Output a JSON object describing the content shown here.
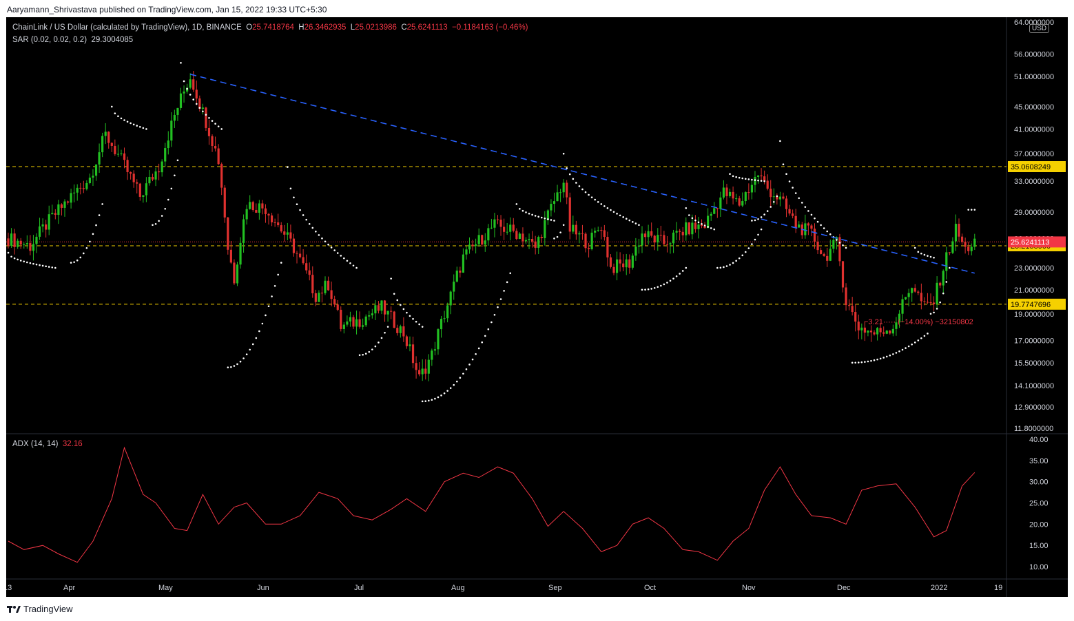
{
  "publisher": "Aaryamann_Shrivastava published on TradingView.com, Jan 15, 2022 19:33 UTC+5:30",
  "legend": {
    "symbol": "ChainLink / US Dollar (calculated by TradingView), 1D, BINANCE",
    "o_label": "O",
    "o": "25.7418764",
    "h_label": "H",
    "h": "26.3462935",
    "l_label": "L",
    "l": "25.0213986",
    "c_label": "C",
    "c": "25.6241113",
    "chg": "−0.1184163 (−0.46%)",
    "sar_label": "SAR (0.02, 0.02, 0.2)",
    "sar_value": "29.3004085",
    "adx_label": "ADX (14, 14)",
    "adx_value": "32.16"
  },
  "currency": "USD",
  "footer": {
    "brand": "TradingView"
  },
  "colors": {
    "background": "#000000",
    "up": "#22c022",
    "down": "#e0312f",
    "sar": "#ffffff",
    "adx": "#f23645",
    "trendline": "#2962ff",
    "hline": "#f5d000",
    "price_line": "#f23645"
  },
  "chart_data": {
    "type": "candlestick",
    "price_axis": {
      "scale": "log",
      "labels": [
        "64.0000000",
        "56.0000000",
        "51.0000000",
        "45.0000000",
        "41.0000000",
        "37.0000000",
        "33.0000000",
        "29.0000000",
        "26.0000000",
        "23.0000000",
        "21.0000000",
        "19.0000000",
        "17.0000000",
        "15.5000000",
        "14.1000000",
        "12.9000000",
        "11.8000000"
      ]
    },
    "time_axis": {
      "labels": [
        "13",
        "Apr",
        "May",
        "Jun",
        "Jul",
        "Aug",
        "Sep",
        "Oct",
        "Nov",
        "Dec",
        "2022",
        "19"
      ]
    },
    "close_path": [
      [
        "Mar 13",
        26.0
      ],
      [
        "Mar 20",
        25.2
      ],
      [
        "Mar 25",
        27.5
      ],
      [
        "Apr 1",
        30.5
      ],
      [
        "Apr 8",
        33.5
      ],
      [
        "Apr 13",
        40.0
      ],
      [
        "Apr 18",
        36.0
      ],
      [
        "Apr 24",
        31.0
      ],
      [
        "Apr 30",
        35.0
      ],
      [
        "May 6",
        45.0
      ],
      [
        "May 10",
        51.0
      ],
      [
        "May 14",
        44.0
      ],
      [
        "May 19",
        36.0
      ],
      [
        "May 22",
        25.0
      ],
      [
        "May 24",
        22.0
      ],
      [
        "May 28",
        30.0
      ],
      [
        "Jun 3",
        29.5
      ],
      [
        "Jun 12",
        25.0
      ],
      [
        "Jun 19",
        20.5
      ],
      [
        "Jun 23",
        21.5
      ],
      [
        "Jun 27",
        18.0
      ],
      [
        "Jul 3",
        18.5
      ],
      [
        "Jul 10",
        19.5
      ],
      [
        "Jul 17",
        17.5
      ],
      [
        "Jul 22",
        14.5
      ],
      [
        "Jul 26",
        16.0
      ],
      [
        "Aug 1",
        20.5
      ],
      [
        "Aug 5",
        24.0
      ],
      [
        "Aug 15",
        27.5
      ],
      [
        "Aug 23",
        26.5
      ],
      [
        "Aug 28",
        25.0
      ],
      [
        "Sep 2",
        29.5
      ],
      [
        "Sep 6",
        33.0
      ],
      [
        "Sep 8",
        27.0
      ],
      [
        "Sep 14",
        25.5
      ],
      [
        "Sep 18",
        27.5
      ],
      [
        "Sep 21",
        23.0
      ],
      [
        "Sep 27",
        23.5
      ],
      [
        "Oct 1",
        26.5
      ],
      [
        "Oct 8",
        25.5
      ],
      [
        "Oct 15",
        27.0
      ],
      [
        "Oct 21",
        27.5
      ],
      [
        "Oct 27",
        31.5
      ],
      [
        "Nov 1",
        30.0
      ],
      [
        "Nov 7",
        34.0
      ],
      [
        "Nov 10",
        32.0
      ],
      [
        "Nov 14",
        30.5
      ],
      [
        "Nov 19",
        27.5
      ],
      [
        "Nov 24",
        26.5
      ],
      [
        "Nov 28",
        24.0
      ],
      [
        "Dec 2",
        25.5
      ],
      [
        "Dec 5",
        20.0
      ],
      [
        "Dec 9",
        18.0
      ],
      [
        "Dec 14",
        17.5
      ],
      [
        "Dec 20",
        18.0
      ],
      [
        "Dec 26",
        21.5
      ],
      [
        "Dec 30",
        19.5
      ],
      [
        "Jan 2",
        20.0
      ],
      [
        "Jan 6",
        24.0
      ],
      [
        "Jan 9",
        27.0
      ],
      [
        "Jan 12",
        24.8
      ],
      [
        "Jan 15",
        25.6241113
      ]
    ],
    "sar_segments": [
      {
        "from": "Mar 13",
        "to": "Mar 28",
        "start": 24.5,
        "end": 23.0,
        "side": "above"
      },
      {
        "from": "Apr 2",
        "to": "Apr 12",
        "start": 23.5,
        "end": 30.0,
        "side": "below"
      },
      {
        "from": "Apr 15",
        "to": "Apr 26",
        "start": 45.0,
        "end": 41.0,
        "side": "above"
      },
      {
        "from": "Apr 28",
        "to": "May 6",
        "start": 27.5,
        "end": 36.0,
        "side": "below"
      },
      {
        "from": "May 7",
        "to": "May 20",
        "start": 54.0,
        "end": 41.0,
        "side": "above"
      },
      {
        "from": "May 22",
        "to": "Jun 8",
        "start": 15.2,
        "end": 23.5,
        "side": "below"
      },
      {
        "from": "Jun 10",
        "to": "Jul 2",
        "start": 35.0,
        "end": 23.0,
        "side": "above"
      },
      {
        "from": "Jul 3",
        "to": "Jul 12",
        "start": 16.0,
        "end": 18.0,
        "side": "below"
      },
      {
        "from": "Jul 13",
        "to": "Jul 23",
        "start": 22.0,
        "end": 18.0,
        "side": "above"
      },
      {
        "from": "Jul 23",
        "to": "Aug 20",
        "start": 13.2,
        "end": 22.5,
        "side": "below"
      },
      {
        "from": "Aug 22",
        "to": "Sep 3",
        "start": 30.0,
        "end": 28.0,
        "side": "above"
      },
      {
        "from": "Sep 3",
        "to": "Sep 6",
        "start": 26.0,
        "end": 27.5,
        "side": "below"
      },
      {
        "from": "Sep 6",
        "to": "Sep 30",
        "start": 37.0,
        "end": 27.5,
        "side": "above"
      },
      {
        "from": "Oct 1",
        "to": "Oct 15",
        "start": 21.0,
        "end": 23.0,
        "side": "below"
      },
      {
        "from": "Oct 15",
        "to": "Oct 24",
        "start": 29.5,
        "end": 27.0,
        "side": "above"
      },
      {
        "from": "Oct 25",
        "to": "Nov 8",
        "start": 23.0,
        "end": 27.0,
        "side": "below"
      },
      {
        "from": "Oct 29",
        "to": "Nov 9",
        "start": 34.0,
        "end": 33.0,
        "side": "above"
      },
      {
        "from": "Nov 5",
        "to": "Nov 13",
        "start": 28.0,
        "end": 31.0,
        "side": "below"
      },
      {
        "from": "Nov 14",
        "to": "Dec 5",
        "start": 39.0,
        "end": 25.0,
        "side": "above"
      },
      {
        "from": "Dec 7",
        "to": "Dec 31",
        "start": 15.5,
        "end": 17.5,
        "side": "below"
      },
      {
        "from": "Dec 27",
        "to": "Jan 2",
        "start": 25.0,
        "end": 24.0,
        "side": "above"
      },
      {
        "from": "Jan 1",
        "to": "Jan 7",
        "start": 19.0,
        "end": 23.0,
        "side": "below"
      },
      {
        "from": "Jan 13",
        "to": "Jan 15",
        "start": 29.3004085,
        "end": 29.3004085,
        "side": "above"
      }
    ],
    "trendline": {
      "from": [
        "May 10",
        51.5
      ],
      "to": [
        "Jan 15",
        22.5
      ],
      "style": "dashed"
    },
    "horizontal_levels": [
      {
        "value": 35.0608249,
        "label": "35.0608249"
      },
      {
        "value": 25.21589,
        "label": "25.2158900"
      },
      {
        "value": 19.7747696,
        "label": "19.7747696"
      }
    ],
    "last_price": {
      "value": 25.6241113,
      "label": "25.6241113"
    },
    "measure_annotation": "−3.21····· (−14.00%) −32150802",
    "adx": {
      "axis_labels": [
        "40.00",
        "35.00",
        "30.00",
        "25.00",
        "20.00",
        "15.00",
        "10.00"
      ],
      "values": [
        [
          "Mar 13",
          16.0
        ],
        [
          "Mar 18",
          14.0
        ],
        [
          "Mar 24",
          15.0
        ],
        [
          "Mar 29",
          13.0
        ],
        [
          "Apr 4",
          11.0
        ],
        [
          "Apr 9",
          16.0
        ],
        [
          "Apr 15",
          26.0
        ],
        [
          "Apr 19",
          38.0
        ],
        [
          "Apr 25",
          27.0
        ],
        [
          "Apr 29",
          25.0
        ],
        [
          "May 5",
          19.0
        ],
        [
          "May 9",
          18.5
        ],
        [
          "May 14",
          27.0
        ],
        [
          "May 19",
          20.0
        ],
        [
          "May 24",
          24.0
        ],
        [
          "May 28",
          25.0
        ],
        [
          "Jun 3",
          20.0
        ],
        [
          "Jun 8",
          20.0
        ],
        [
          "Jun 14",
          22.0
        ],
        [
          "Jun 20",
          27.5
        ],
        [
          "Jun 26",
          26.0
        ],
        [
          "Jul 1",
          22.0
        ],
        [
          "Jul 7",
          21.0
        ],
        [
          "Jul 13",
          23.5
        ],
        [
          "Jul 18",
          26.0
        ],
        [
          "Jul 24",
          23.0
        ],
        [
          "Jul 30",
          30.0
        ],
        [
          "Aug 5",
          32.0
        ],
        [
          "Aug 10",
          31.0
        ],
        [
          "Aug 16",
          33.5
        ],
        [
          "Aug 21",
          32.0
        ],
        [
          "Aug 27",
          26.0
        ],
        [
          "Sep 1",
          19.5
        ],
        [
          "Sep 6",
          23.0
        ],
        [
          "Sep 12",
          19.0
        ],
        [
          "Sep 18",
          13.5
        ],
        [
          "Sep 23",
          15.0
        ],
        [
          "Sep 28",
          20.0
        ],
        [
          "Oct 3",
          21.5
        ],
        [
          "Oct 8",
          19.0
        ],
        [
          "Oct 14",
          14.0
        ],
        [
          "Oct 19",
          13.5
        ],
        [
          "Oct 25",
          11.5
        ],
        [
          "Oct 30",
          16.0
        ],
        [
          "Nov 4",
          19.0
        ],
        [
          "Nov 9",
          28.0
        ],
        [
          "Nov 14",
          33.5
        ],
        [
          "Nov 19",
          27.0
        ],
        [
          "Nov 24",
          22.0
        ],
        [
          "Nov 30",
          21.5
        ],
        [
          "Dec 5",
          20.0
        ],
        [
          "Dec 10",
          28.0
        ],
        [
          "Dec 15",
          29.0
        ],
        [
          "Dec 21",
          29.5
        ],
        [
          "Dec 27",
          24.0
        ],
        [
          "Jan 2",
          17.0
        ],
        [
          "Jan 6",
          18.5
        ],
        [
          "Jan 11",
          29.0
        ],
        [
          "Jan 15",
          32.16
        ]
      ]
    }
  }
}
